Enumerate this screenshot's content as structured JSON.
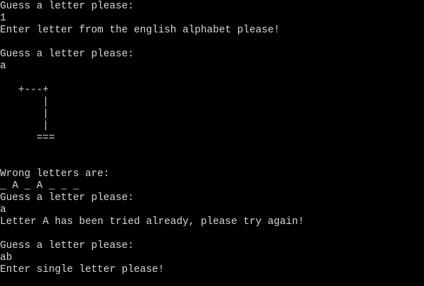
{
  "terminal": {
    "lines": [
      "Guess a letter please:",
      "1",
      "Enter letter from the english alphabet please!",
      "",
      "Guess a letter please:",
      "a",
      "",
      "   +---+",
      "       |",
      "       |",
      "       |",
      "      ===",
      "",
      "",
      "Wrong letters are:",
      "_ A _ A _ _ _",
      "Guess a letter please:",
      "a",
      "Letter A has been tried already, please try again!",
      "",
      "Guess a letter please:",
      "ab",
      "Enter single letter please!"
    ]
  },
  "colors": {
    "background": "#000000",
    "text": "#d6d6d6"
  }
}
